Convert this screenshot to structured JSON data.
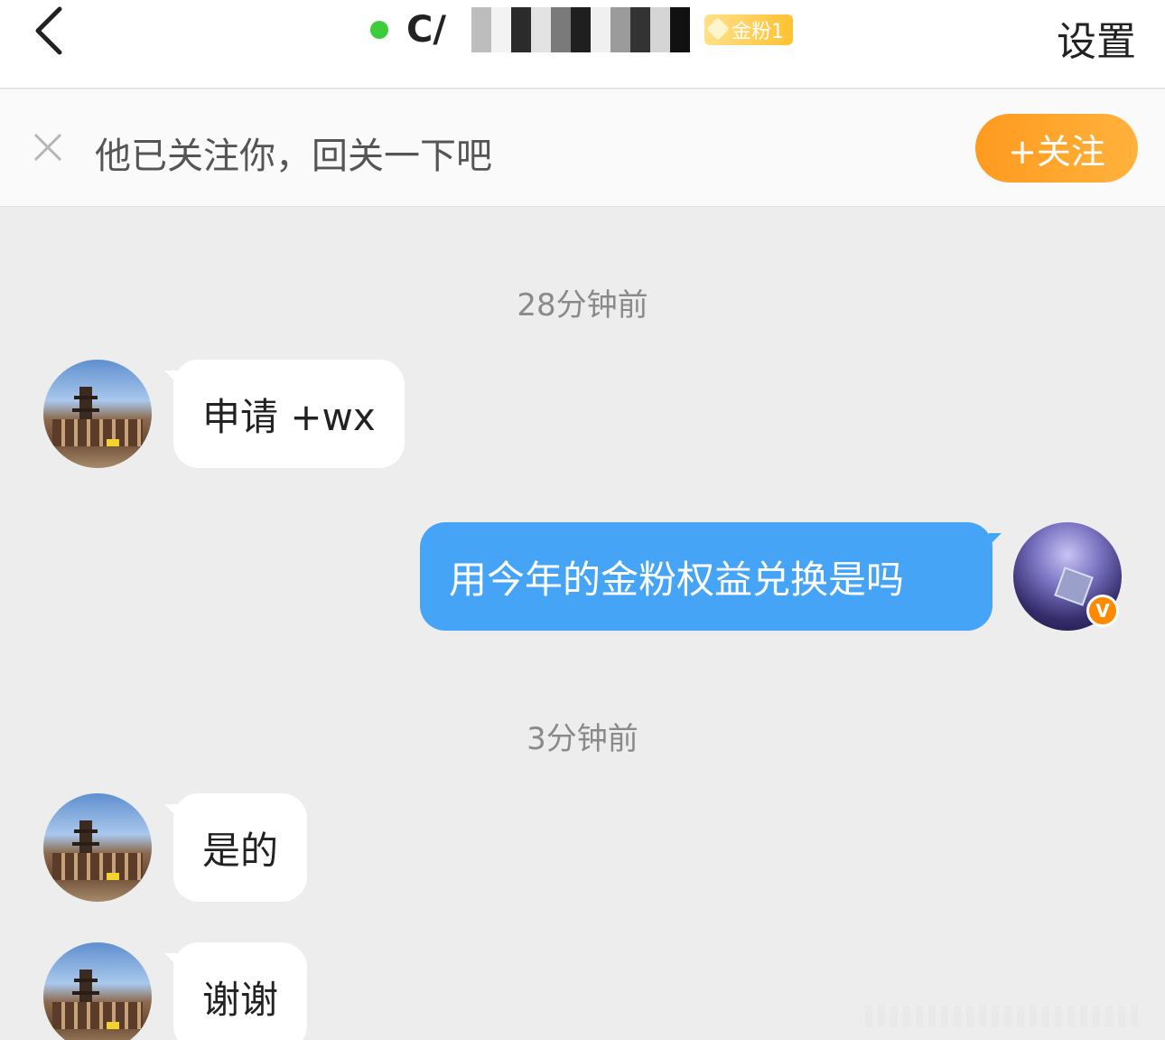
{
  "header": {
    "title_visible": "C/",
    "badge_label": "金粉1",
    "settings_label": "设置"
  },
  "follow_bar": {
    "text": "他已关注你，回关一下吧",
    "button_label": "+关注"
  },
  "messages": {
    "ts1": "28分钟前",
    "m1": "申请 +wx",
    "m2": "用今年的金粉权益兑换是吗",
    "ts2": "3分钟前",
    "m3": "是的",
    "m4": "谢谢"
  },
  "badges": {
    "verified": "V"
  },
  "colors": {
    "accent_orange": "#ff9a1f",
    "sent_bubble": "#46a4f6",
    "online": "#3ccc3c",
    "background": "#ededed"
  },
  "icons": [
    "back-arrow-icon",
    "close-icon",
    "online-dot-icon",
    "gem-icon",
    "verified-v-icon"
  ]
}
